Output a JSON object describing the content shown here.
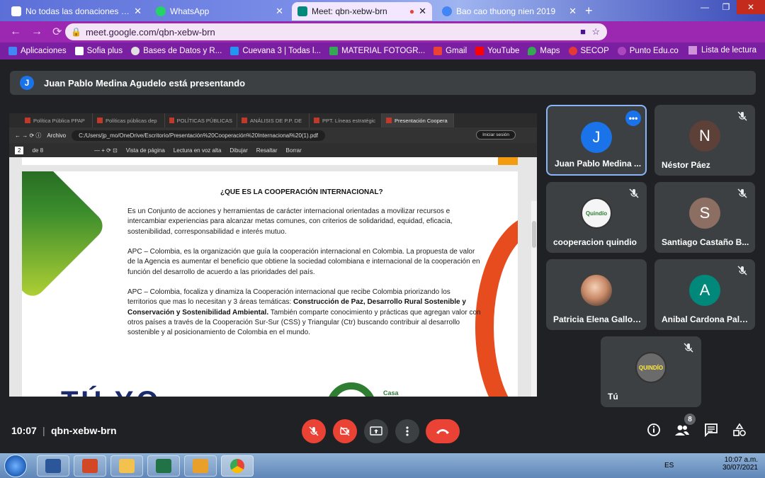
{
  "browser": {
    "tabs": [
      {
        "label": "No todas las donaciones a N...",
        "color": "#ffffff"
      },
      {
        "label": "WhatsApp",
        "color": "#25d366"
      },
      {
        "label": "Meet: qbn-xebw-brn",
        "color": "#00897b"
      },
      {
        "label": "Bao cao thuong nien 2019",
        "color": "#4285f4"
      }
    ],
    "url": "meet.google.com/qbn-xebw-brn",
    "bookmarks": [
      "Aplicaciones",
      "Sofia plus",
      "Bases de Datos y R...",
      "Cuevana 3 | Todas l...",
      "MATERIAL FOTOGR...",
      "Gmail",
      "YouTube",
      "Maps",
      "SECOP",
      "Punto Edu.co"
    ],
    "reading_list": "Lista de lectura"
  },
  "meet": {
    "presenting_initial": "J",
    "presenting_text": "Juan Pablo Medina Agudelo está presentando",
    "time": "10:07",
    "separator": "|",
    "meeting_code": "qbn-xebw-brn",
    "participant_count": "8"
  },
  "shared": {
    "tabs": [
      "Política Pública PPAP",
      "Políticas públicas dep",
      "POLÍTICAS PÚBLICAS",
      "ANÁLISIS DE P.P. DE",
      "PPT. Líneas estratégic",
      "Presentación Coopera"
    ],
    "file_label": "Archivo",
    "file_path": "C:/Users/jp_mo/OneDrive/Escritorio/Presentación%20Cooperación%20Internacional%20(1).pdf",
    "sign_in": "Iniciar sesión",
    "page_num": "2",
    "page_total": "de 8",
    "tools": [
      "Vista de página",
      "Lectura en voz alta",
      "Dibujar",
      "Resaltar",
      "Borrar"
    ],
    "title": "¿QUE ES LA COOPERACIÓN INTERNACIONAL?",
    "para1": "Es un Conjunto de acciones y herramientas de carácter internacional orientadas a movilizar recursos e intercambiar experiencias para alcanzar metas comunes, con criterios de solidaridad, equidad, eficacia, sostenibilidad, corresponsabilidad e interés mutuo.",
    "para2": "APC – Colombia, es la organización que guía la cooperación internacional en Colombia. La propuesta de valor de la Agencia es aumentar el beneficio que obtiene la sociedad colombiana e internacional de la cooperación en función del desarrollo de acuerdo a las prioridades del país.",
    "para3_a": "APC – Colombia, focaliza y dinamiza la Cooperación internacional que recibe Colombia priorizando los territorios que mas lo necesitan y 3 áreas temáticas:",
    "para3_b": "Construcción de Paz, Desarrollo Rural Sostenible y Conservación y Sostenibilidad Ambiental.",
    "para3_c": "También comparte conocimiento y prácticas que agregan valor con otros países a través de la Cooperación Sur-Sur (CSS) y Triangular (Ctr) buscando contribuir al desarrollo sostenible y al posicionamiento de Colombia en el mundo.",
    "logo_left": "TÚ YO",
    "logo_right": "Casa"
  },
  "participants": [
    {
      "name": "Juan Pablo Medina ...",
      "initial": "J",
      "color": "#1a73e8",
      "muted": false,
      "speaking": true
    },
    {
      "name": "Néstor Páez",
      "initial": "N",
      "color": "#5d4037",
      "muted": true
    },
    {
      "name": "cooperacion quindio",
      "initial": "",
      "logo": "Quindío",
      "muted": true
    },
    {
      "name": "Santiago Castaño B...",
      "initial": "S",
      "color": "#8d6e63",
      "muted": true
    },
    {
      "name": "Patricia Elena Gallo ...",
      "initial": "",
      "photo": true,
      "muted": false
    },
    {
      "name": "Anibal Cardona Pala...",
      "initial": "A",
      "color": "#00897b",
      "muted": true
    },
    {
      "name": "Tú",
      "initial": "",
      "logo": "QUINDÍO",
      "muted": true
    }
  ],
  "taskbar": {
    "lang": "ES",
    "time": "10:07 a.m.",
    "date": "30/07/2021"
  }
}
